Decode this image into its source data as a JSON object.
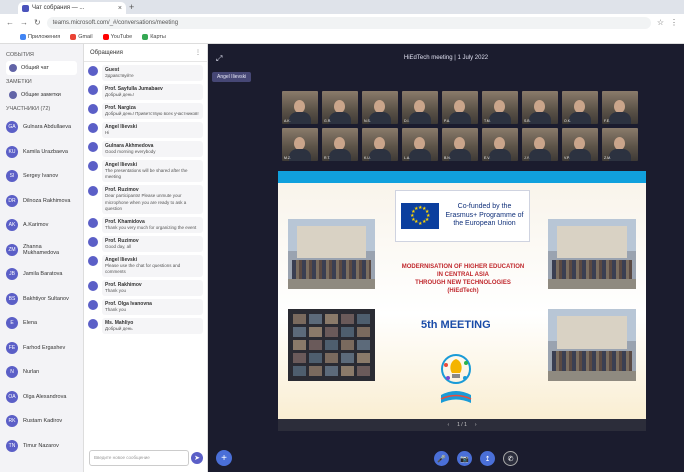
{
  "browser": {
    "tab_title": "Чат собрания — ...",
    "url": "teams.microsoft.com/_#/conversations/meeting",
    "bookmarks": [
      {
        "label": "Приложения",
        "color": "#4285f4"
      },
      {
        "label": "Gmail",
        "color": "#ea4335"
      },
      {
        "label": "YouTube",
        "color": "#ff0000"
      },
      {
        "label": "Карты",
        "color": "#34a853"
      }
    ]
  },
  "rail": {
    "sections": [
      {
        "label": "СОБЫТИЯ",
        "items": [
          "Общий чат"
        ]
      },
      {
        "label": "ЗАМЕТКИ",
        "items": [
          "Общие заметки"
        ]
      }
    ],
    "participants_head": "УЧАСТНИКИ (72)",
    "participants": [
      {
        "name": "Gulnara Abdullaeva",
        "initials": "GA"
      },
      {
        "name": "Kamila Urazbaeva",
        "initials": "KU"
      },
      {
        "name": "Sergey Ivanov",
        "initials": "SI"
      },
      {
        "name": "Dilnoza Rakhimova",
        "initials": "DR"
      },
      {
        "name": "A.Karimov",
        "initials": "AK"
      },
      {
        "name": "Zhanna Mukhamedova",
        "initials": "ZM"
      },
      {
        "name": "Jamila Baratova",
        "initials": "JB"
      },
      {
        "name": "Bakhtiyor Sultanov",
        "initials": "BS"
      },
      {
        "name": "Elena",
        "initials": "E"
      },
      {
        "name": "Farhod Ergashev",
        "initials": "FE"
      },
      {
        "name": "Nurlan",
        "initials": "N"
      },
      {
        "name": "Olga Alexandrova",
        "initials": "OA"
      },
      {
        "name": "Rustam Kadirov",
        "initials": "RK"
      },
      {
        "name": "Timur Nazarov",
        "initials": "TN"
      }
    ]
  },
  "chat": {
    "header": "Обращения",
    "close_glyph": "⋮",
    "messages": [
      {
        "name": "Guest",
        "text": "Здравствуйте"
      },
      {
        "name": "Prof. Sayfulla Jumabaev",
        "text": "Добрый день!"
      },
      {
        "name": "Prof. Nargiza",
        "text": "Добрый день! Приветствую всех участников!"
      },
      {
        "name": "Angel Ilievski",
        "text": "Hi"
      },
      {
        "name": "Gulnara Akhmedova",
        "text": "Good morning everybody"
      },
      {
        "name": "Angel Ilievski",
        "text": "The presentations will be shared after the meeting"
      },
      {
        "name": "Prof. Ruzimov",
        "text": "Dear participants! Please unmute your microphone when you are ready to ask a question"
      },
      {
        "name": "Prof. Khamidova",
        "text": "Thank you very much for organizing the event"
      },
      {
        "name": "Prof. Ruzimov",
        "text": "Good day, all"
      },
      {
        "name": "Angel Ilievski",
        "text": "Please use the chat for questions and comments"
      },
      {
        "name": "Prof. Rakhimov",
        "text": "Thank you"
      },
      {
        "name": "Prof. Olga Ivanovna",
        "text": "Thank you"
      },
      {
        "name": "Ms. Mahliyo",
        "text": "Добрый день"
      }
    ],
    "compose_placeholder": "Введите новое сообщение"
  },
  "meeting": {
    "title": "HiEdTech meeting | 1 July 2022",
    "sharing_chip": "Angel Ilievski",
    "participants": [
      "A.K.",
      "G.R.",
      "N.S.",
      "D.I.",
      "P.A.",
      "T.M.",
      "S.B.",
      "O.K.",
      "F.E.",
      "M.Z.",
      "R.T.",
      "K.U.",
      "L.A.",
      "B.N.",
      "E.V.",
      "J.Y.",
      "V.P.",
      "Z.M."
    ],
    "slide": {
      "eu_text": "Co-funded by the Erasmus+ Programme of the European Union",
      "headline_lines": [
        "MODERNISATION OF HIGHER EDUCATION",
        "IN CENTRAL ASIA",
        "THROUGH NEW TECHNOLOGIES",
        "(HiEdTech)"
      ],
      "meeting_label": "5th MEETING",
      "pager": "1 / 1"
    }
  },
  "controls": {
    "fab_glyph": "+",
    "buttons": [
      "🎤",
      "📷",
      "↥",
      "✆"
    ]
  }
}
